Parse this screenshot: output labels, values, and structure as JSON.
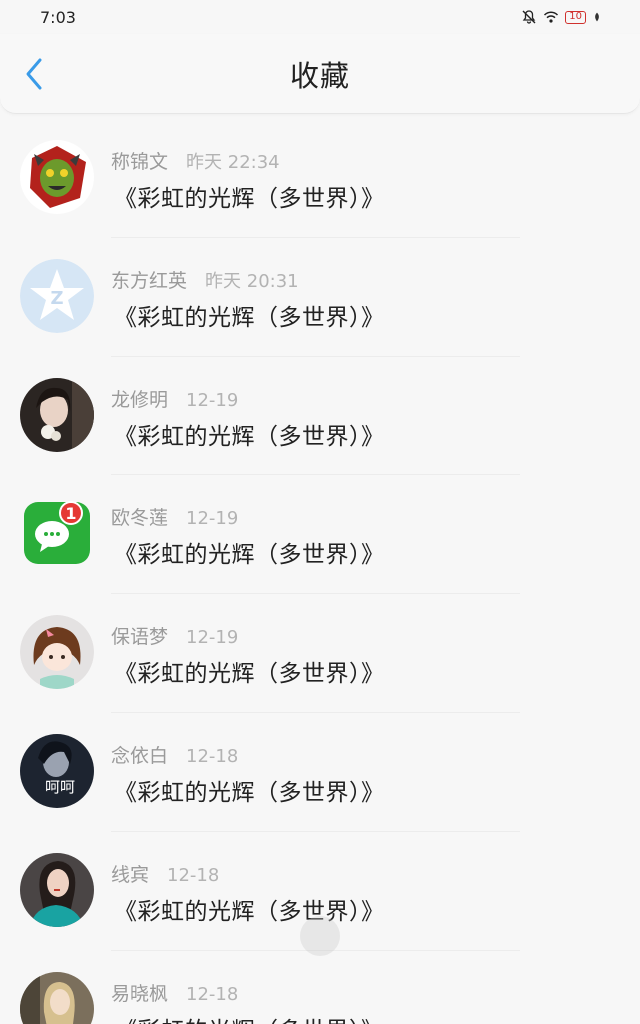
{
  "status_bar": {
    "time": "7:03",
    "battery": "10",
    "icons": [
      "mute-icon",
      "wifi-icon",
      "battery-icon",
      "leaf-icon"
    ]
  },
  "nav": {
    "title": "收藏",
    "back_icon": "chevron-left-icon",
    "accent": "#3a9be8"
  },
  "items": [
    {
      "name": "称锦文",
      "time": "昨天 22:34",
      "message": "《彩虹的光辉（多世界）》",
      "avatar": "monster-avatar"
    },
    {
      "name": "东方红英",
      "time": "昨天 20:31",
      "message": "《彩虹的光辉（多世界）》",
      "avatar": "star-avatar"
    },
    {
      "name": "龙修明",
      "time": "12-19",
      "message": "《彩虹的光辉（多世界）》",
      "avatar": "girl-flower-avatar"
    },
    {
      "name": "欧冬莲",
      "time": "12-19",
      "message": "《彩虹的光辉（多世界）》",
      "avatar": "wechat-avatar"
    },
    {
      "name": "保语梦",
      "time": "12-19",
      "message": "《彩虹的光辉（多世界）》",
      "avatar": "cartoon-girl-avatar"
    },
    {
      "name": "念依白",
      "time": "12-18",
      "message": "《彩虹的光辉（多世界）》",
      "avatar": "hehe-avatar"
    },
    {
      "name": "线宾",
      "time": "12-18",
      "message": "《彩虹的光辉（多世界）》",
      "avatar": "woman-teal-avatar"
    },
    {
      "name": "易晓枫",
      "time": "12-18",
      "message": "《彩虹的光辉（多世界）》",
      "avatar": "blonde-avatar"
    }
  ],
  "avatar_extras": {
    "wechat_badge": "1",
    "hehe_text": "呵呵"
  }
}
